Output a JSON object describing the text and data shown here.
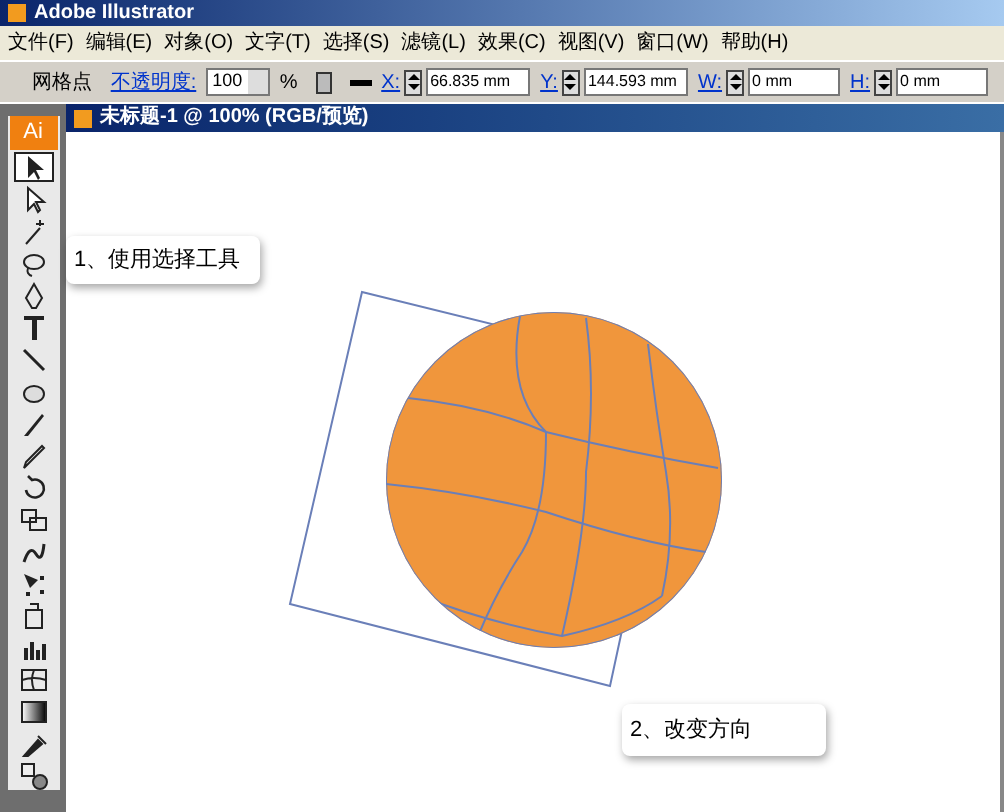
{
  "window": {
    "title": "Adobe Illustrator"
  },
  "menu": [
    "文件(F)",
    "编辑(E)",
    "对象(O)",
    "文字(T)",
    "选择(S)",
    "滤镜(L)",
    "效果(C)",
    "视图(V)",
    "窗口(W)",
    "帮助(H)"
  ],
  "control_bar": {
    "object_label": "网格点",
    "opacity_label": "不透明度:",
    "opacity_value": "100",
    "percent": "%",
    "fields": [
      {
        "label": "X:",
        "value": "66.835 mm"
      },
      {
        "label": "Y:",
        "value": "144.593 mm"
      },
      {
        "label": "W:",
        "value": "0 mm"
      },
      {
        "label": "H:",
        "value": "0 mm"
      }
    ]
  },
  "toolbox": {
    "logo": "Ai",
    "tools": [
      {
        "kind": "select",
        "selected": true
      },
      {
        "kind": "direct",
        "selected": false
      },
      {
        "kind": "wand",
        "selected": false
      },
      {
        "kind": "lasso",
        "selected": false
      },
      {
        "kind": "pen",
        "selected": false
      },
      {
        "kind": "type",
        "selected": false
      },
      {
        "kind": "line",
        "selected": false
      },
      {
        "kind": "ellipse",
        "selected": false
      },
      {
        "kind": "brush",
        "selected": false
      },
      {
        "kind": "pencil",
        "selected": false
      },
      {
        "kind": "rotate",
        "selected": false
      },
      {
        "kind": "scale",
        "selected": false
      },
      {
        "kind": "warp",
        "selected": false
      },
      {
        "kind": "free",
        "selected": false
      },
      {
        "kind": "symbol",
        "selected": false
      },
      {
        "kind": "graph",
        "selected": false
      },
      {
        "kind": "mesh",
        "selected": false
      },
      {
        "kind": "gradient",
        "selected": false
      },
      {
        "kind": "eyedropper",
        "selected": false
      },
      {
        "kind": "blend",
        "selected": false
      }
    ]
  },
  "document": {
    "title": "未标题-1 @ 100% (RGB/预览)"
  },
  "callouts": [
    "1、使用选择工具",
    "2、改变方向"
  ]
}
